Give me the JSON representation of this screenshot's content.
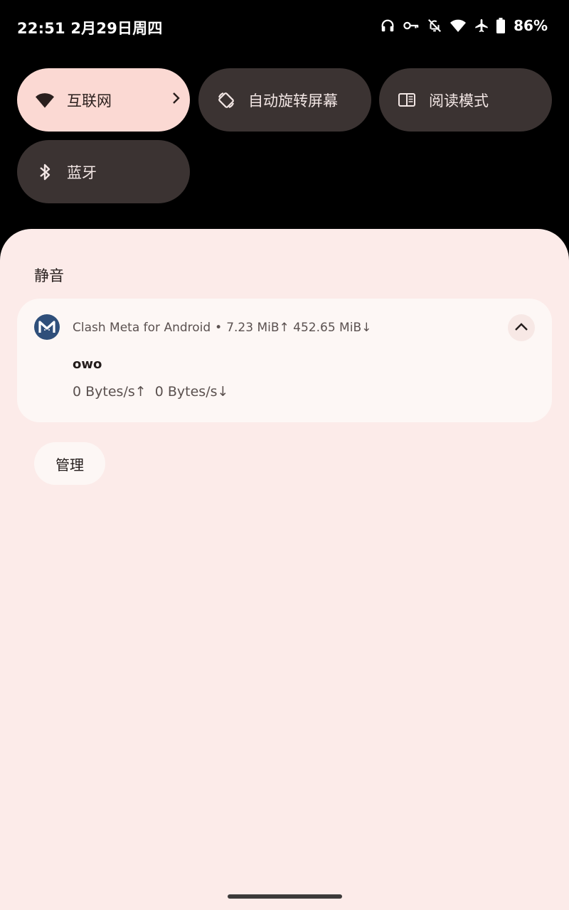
{
  "status_bar": {
    "time": "22:51",
    "date": "2月29日周四",
    "icons": [
      "headphones-icon",
      "key-icon",
      "bell-off-icon",
      "wifi-icon",
      "airplane-icon",
      "battery-icon"
    ],
    "battery": "86%"
  },
  "quick_settings": {
    "tiles": [
      {
        "label": "互联网",
        "icon": "wifi-icon",
        "active": true
      },
      {
        "label": "自动旋转屏幕",
        "icon": "auto-rotate-icon",
        "active": false
      },
      {
        "label": "阅读模式",
        "icon": "reading-mode-icon",
        "active": false
      },
      {
        "label": "蓝牙",
        "icon": "bluetooth-icon",
        "active": false
      }
    ]
  },
  "notifications": {
    "section_title": "静音",
    "card": {
      "app_name": "Clash Meta for Android",
      "separator": "•",
      "summary": "7.23 MiB↑ 452.65 MiB↓",
      "title": "owo",
      "body": "0 Bytes/s↑  0 Bytes/s↓"
    },
    "manage_label": "管理"
  },
  "colors": {
    "active_tile": "#fbd9d3",
    "inactive_tile": "#3b3332",
    "shade_bg": "#fcebe9",
    "card_bg": "#fdf7f5",
    "app_icon_bg": "#2f4f7a"
  }
}
